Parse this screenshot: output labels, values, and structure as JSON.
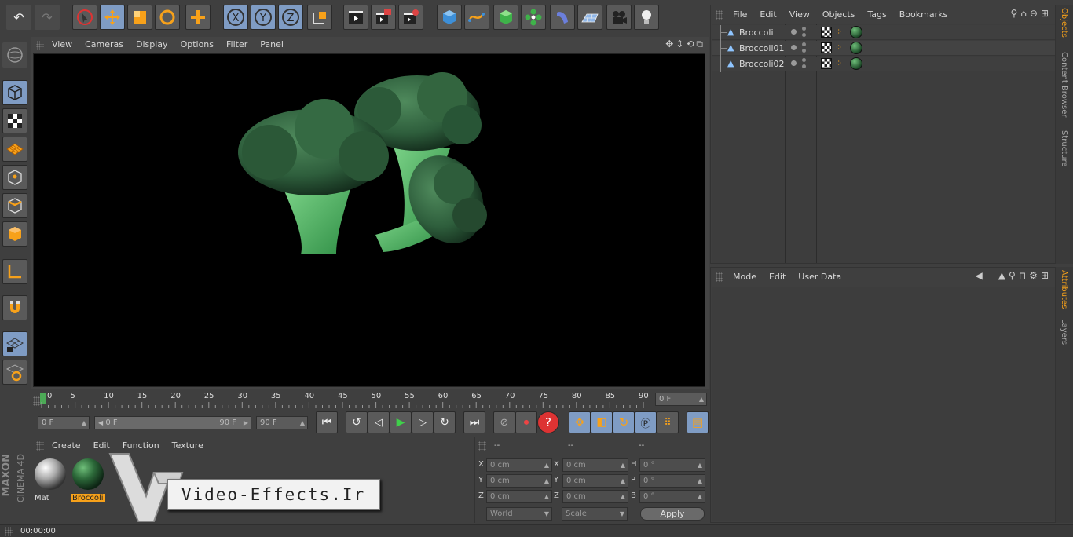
{
  "viewport": {
    "menu": [
      "View",
      "Cameras",
      "Display",
      "Options",
      "Filter",
      "Panel"
    ]
  },
  "objects": {
    "menu": [
      "File",
      "Edit",
      "View",
      "Objects",
      "Tags",
      "Bookmarks"
    ],
    "items": [
      "Broccoli",
      "Broccoli01",
      "Broccoli02"
    ]
  },
  "attributes": {
    "menu": [
      "Mode",
      "Edit",
      "User Data"
    ]
  },
  "side_tabs_top": [
    "Objects",
    "Content Browser",
    "Structure"
  ],
  "side_tabs_bottom": [
    "Attributes",
    "Layers"
  ],
  "timeline": {
    "ticks": [
      "0",
      "5",
      "10",
      "15",
      "20",
      "25",
      "30",
      "35",
      "40",
      "45",
      "50",
      "55",
      "60",
      "65",
      "70",
      "75",
      "80",
      "85",
      "90"
    ],
    "current_frame": "0 F",
    "start_frame": "0 F",
    "range_start": "0 F",
    "range_end": "90 F",
    "end_frame": "90 F"
  },
  "materials": {
    "menu": [
      "Create",
      "Edit",
      "Function",
      "Texture"
    ],
    "items": [
      {
        "name": "Mat"
      },
      {
        "name": "Broccoli"
      }
    ]
  },
  "coordinates": {
    "headers": [
      "--",
      "--",
      "--"
    ],
    "rows": [
      {
        "l1": "X",
        "v1": "0 cm",
        "l2": "X",
        "v2": "0 cm",
        "l3": "H",
        "v3": "0 °"
      },
      {
        "l1": "Y",
        "v1": "0 cm",
        "l2": "Y",
        "v2": "0 cm",
        "l3": "P",
        "v3": "0 °"
      },
      {
        "l1": "Z",
        "v1": "0 cm",
        "l2": "Z",
        "v2": "0 cm",
        "l3": "B",
        "v3": "0 °"
      }
    ],
    "mode_select": "World",
    "type_select": "Scale",
    "apply_label": "Apply"
  },
  "status": {
    "time": "00:00:00"
  },
  "branding": {
    "maxon": "MAXON",
    "cinema": "CINEMA 4D",
    "watermark": "Video-Effects.Ir"
  },
  "colors": {
    "accent": "#f7a11a",
    "active_tool": "#7f9cc4",
    "viewport_bg": "#000000"
  }
}
